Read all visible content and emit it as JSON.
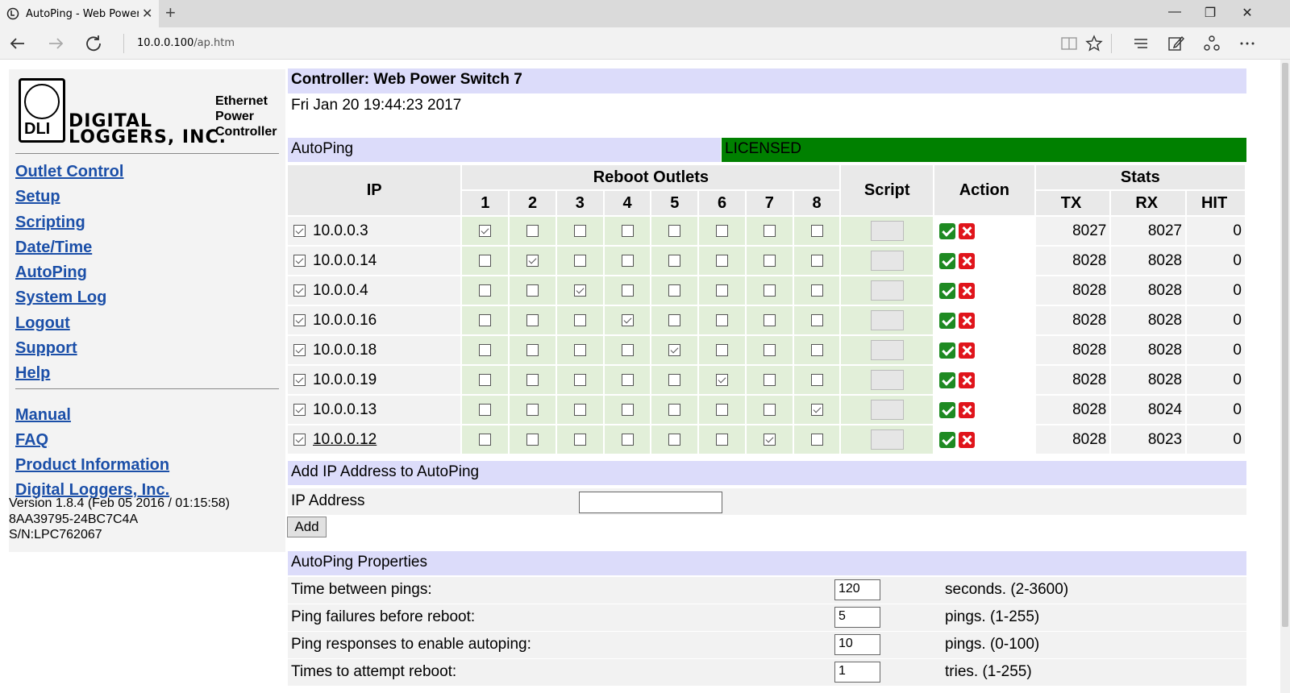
{
  "browser": {
    "tab_title": "AutoPing - Web Power",
    "url_host": "10.0.0.100",
    "url_path": "/ap.htm"
  },
  "logo": {
    "mark": "DLI",
    "line1": "DIGITAL",
    "line2": "LOGGERS, INC.",
    "tag1": "Ethernet",
    "tag2": "Power",
    "tag3": "Controller"
  },
  "nav": {
    "primary": [
      "Outlet Control",
      "Setup",
      "Scripting",
      "Date/Time",
      "AutoPing",
      "System Log",
      "Logout",
      "Support",
      "Help"
    ],
    "secondary": [
      "Manual",
      "FAQ",
      "Product Information",
      "Digital Loggers, Inc."
    ]
  },
  "version": {
    "line1": "Version 1.8.4 (Feb 05 2016 / 01:15:58)",
    "line2": "8AA39795-24BC7C4A",
    "line3": "S/N:LPC762067"
  },
  "controller": {
    "title": "Controller: Web Power Switch 7",
    "datetime": "Fri Jan 20 19:44:23 2017"
  },
  "autoping": {
    "header": "AutoPing",
    "license": "LICENSED",
    "columns": {
      "ip": "IP",
      "reboot_outlets": "Reboot Outlets",
      "outlets": [
        "1",
        "2",
        "3",
        "4",
        "5",
        "6",
        "7",
        "8"
      ],
      "script": "Script",
      "action": "Action",
      "stats": "Stats",
      "tx": "TX",
      "rx": "RX",
      "hit": "HIT"
    },
    "rows": [
      {
        "enabled": true,
        "ip": "10.0.0.3",
        "outlets": [
          true,
          false,
          false,
          false,
          false,
          false,
          false,
          false
        ],
        "tx": "8027",
        "rx": "8027",
        "hit": "0"
      },
      {
        "enabled": true,
        "ip": "10.0.0.14",
        "outlets": [
          false,
          true,
          false,
          false,
          false,
          false,
          false,
          false
        ],
        "tx": "8028",
        "rx": "8028",
        "hit": "0"
      },
      {
        "enabled": true,
        "ip": "10.0.0.4",
        "outlets": [
          false,
          false,
          true,
          false,
          false,
          false,
          false,
          false
        ],
        "tx": "8028",
        "rx": "8028",
        "hit": "0"
      },
      {
        "enabled": true,
        "ip": "10.0.0.16",
        "outlets": [
          false,
          false,
          false,
          true,
          false,
          false,
          false,
          false
        ],
        "tx": "8028",
        "rx": "8028",
        "hit": "0"
      },
      {
        "enabled": true,
        "ip": "10.0.0.18",
        "outlets": [
          false,
          false,
          false,
          false,
          true,
          false,
          false,
          false
        ],
        "tx": "8028",
        "rx": "8028",
        "hit": "0"
      },
      {
        "enabled": true,
        "ip": "10.0.0.19",
        "outlets": [
          false,
          false,
          false,
          false,
          false,
          true,
          false,
          false
        ],
        "tx": "8028",
        "rx": "8028",
        "hit": "0"
      },
      {
        "enabled": true,
        "ip": "10.0.0.13",
        "outlets": [
          false,
          false,
          false,
          false,
          false,
          false,
          false,
          true
        ],
        "tx": "8028",
        "rx": "8024",
        "hit": "0"
      },
      {
        "enabled": true,
        "ip": "10.0.0.12",
        "outlets": [
          false,
          false,
          false,
          false,
          false,
          false,
          true,
          false
        ],
        "tx": "8028",
        "rx": "8023",
        "hit": "0"
      }
    ]
  },
  "add_ip": {
    "header": "Add IP Address to AutoPing",
    "label": "IP Address",
    "value": "",
    "button": "Add"
  },
  "properties": {
    "header": "AutoPing Properties",
    "items": [
      {
        "label": "Time between pings:",
        "value": "120",
        "unit": "seconds. (2-3600)"
      },
      {
        "label": "Ping failures before reboot:",
        "value": "5",
        "unit": "pings. (1-255)"
      },
      {
        "label": "Ping responses to enable autoping:",
        "value": "10",
        "unit": "pings. (0-100)"
      },
      {
        "label": "Times to attempt reboot:",
        "value": "1",
        "unit": "tries. (1-255)"
      }
    ]
  }
}
